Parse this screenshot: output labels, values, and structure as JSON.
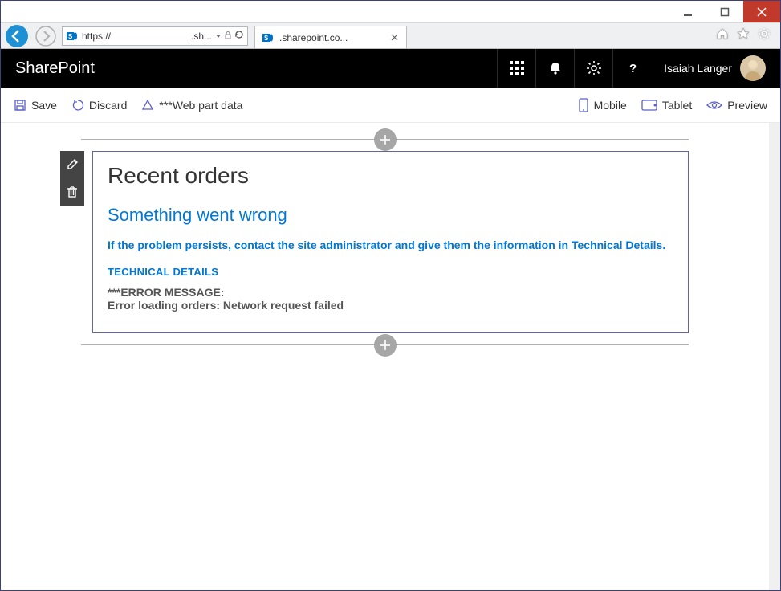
{
  "window": {
    "addr_scheme": "https://",
    "addr_host": ".sh...",
    "tab_title": ".sharepoint.co..."
  },
  "suite": {
    "title": "SharePoint",
    "user_name": "Isaiah Langer"
  },
  "commands": {
    "save": "Save",
    "discard": "Discard",
    "webpartdata": "***Web part data",
    "mobile": "Mobile",
    "tablet": "Tablet",
    "preview": "Preview"
  },
  "webpart": {
    "title": "Recent orders",
    "error_heading": "Something went wrong",
    "error_sub": "If the problem persists, contact the site administrator and give them the information in Technical Details.",
    "tech_label": "TECHNICAL DETAILS",
    "error_label": "***ERROR MESSAGE:",
    "error_message": "Error loading orders: Network request failed"
  }
}
